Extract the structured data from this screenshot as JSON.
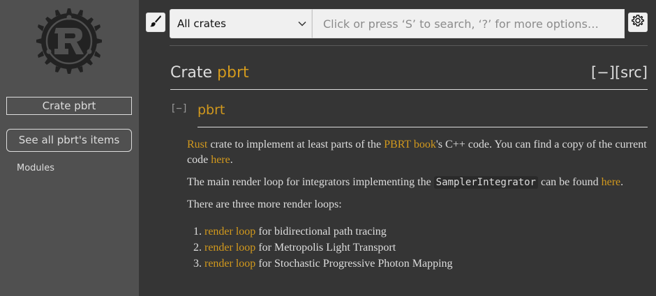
{
  "sidebar": {
    "crate_label": "Crate pbrt",
    "see_all_label": "See all pbrt's items",
    "modules_label": "Modules"
  },
  "search": {
    "crate_filter": "All crates",
    "placeholder": "Click or press ‘S’ to search, ‘?’ for more options…"
  },
  "heading": {
    "prefix": "Crate ",
    "crate_name": "pbrt",
    "toggle_src": "[−][src]"
  },
  "section": {
    "toggle": "[−]",
    "title": "pbrt"
  },
  "docblock": {
    "p1": {
      "rust_link": "Rust",
      "text1": " crate to implement at least parts of the ",
      "book_link": "PBRT book",
      "text2": "'s C++ code. You can find a copy of the current code ",
      "here_link": "here",
      "text3": "."
    },
    "p2": {
      "text1": "The main render loop for integrators implementing the ",
      "code": "SamplerIntegrator",
      "text2": " can be found ",
      "here_link": "here",
      "text3": "."
    },
    "p3": "There are three more render loops:",
    "list": [
      {
        "link": "render loop",
        "text": " for bidirectional path tracing"
      },
      {
        "link": "render loop",
        "text": " for Metropolis Light Transport"
      },
      {
        "link": "render loop",
        "text": " for Stochastic Progressive Photon Mapping"
      }
    ]
  },
  "colors": {
    "background": "#353535",
    "sidebar": "#505050",
    "accent": "#d2991d",
    "text": "#dddddd"
  },
  "icons": {
    "logo": "rust-logo-icon",
    "theme": "paintbrush-icon",
    "dropdown": "chevron-down-icon",
    "settings": "gear-icon"
  }
}
